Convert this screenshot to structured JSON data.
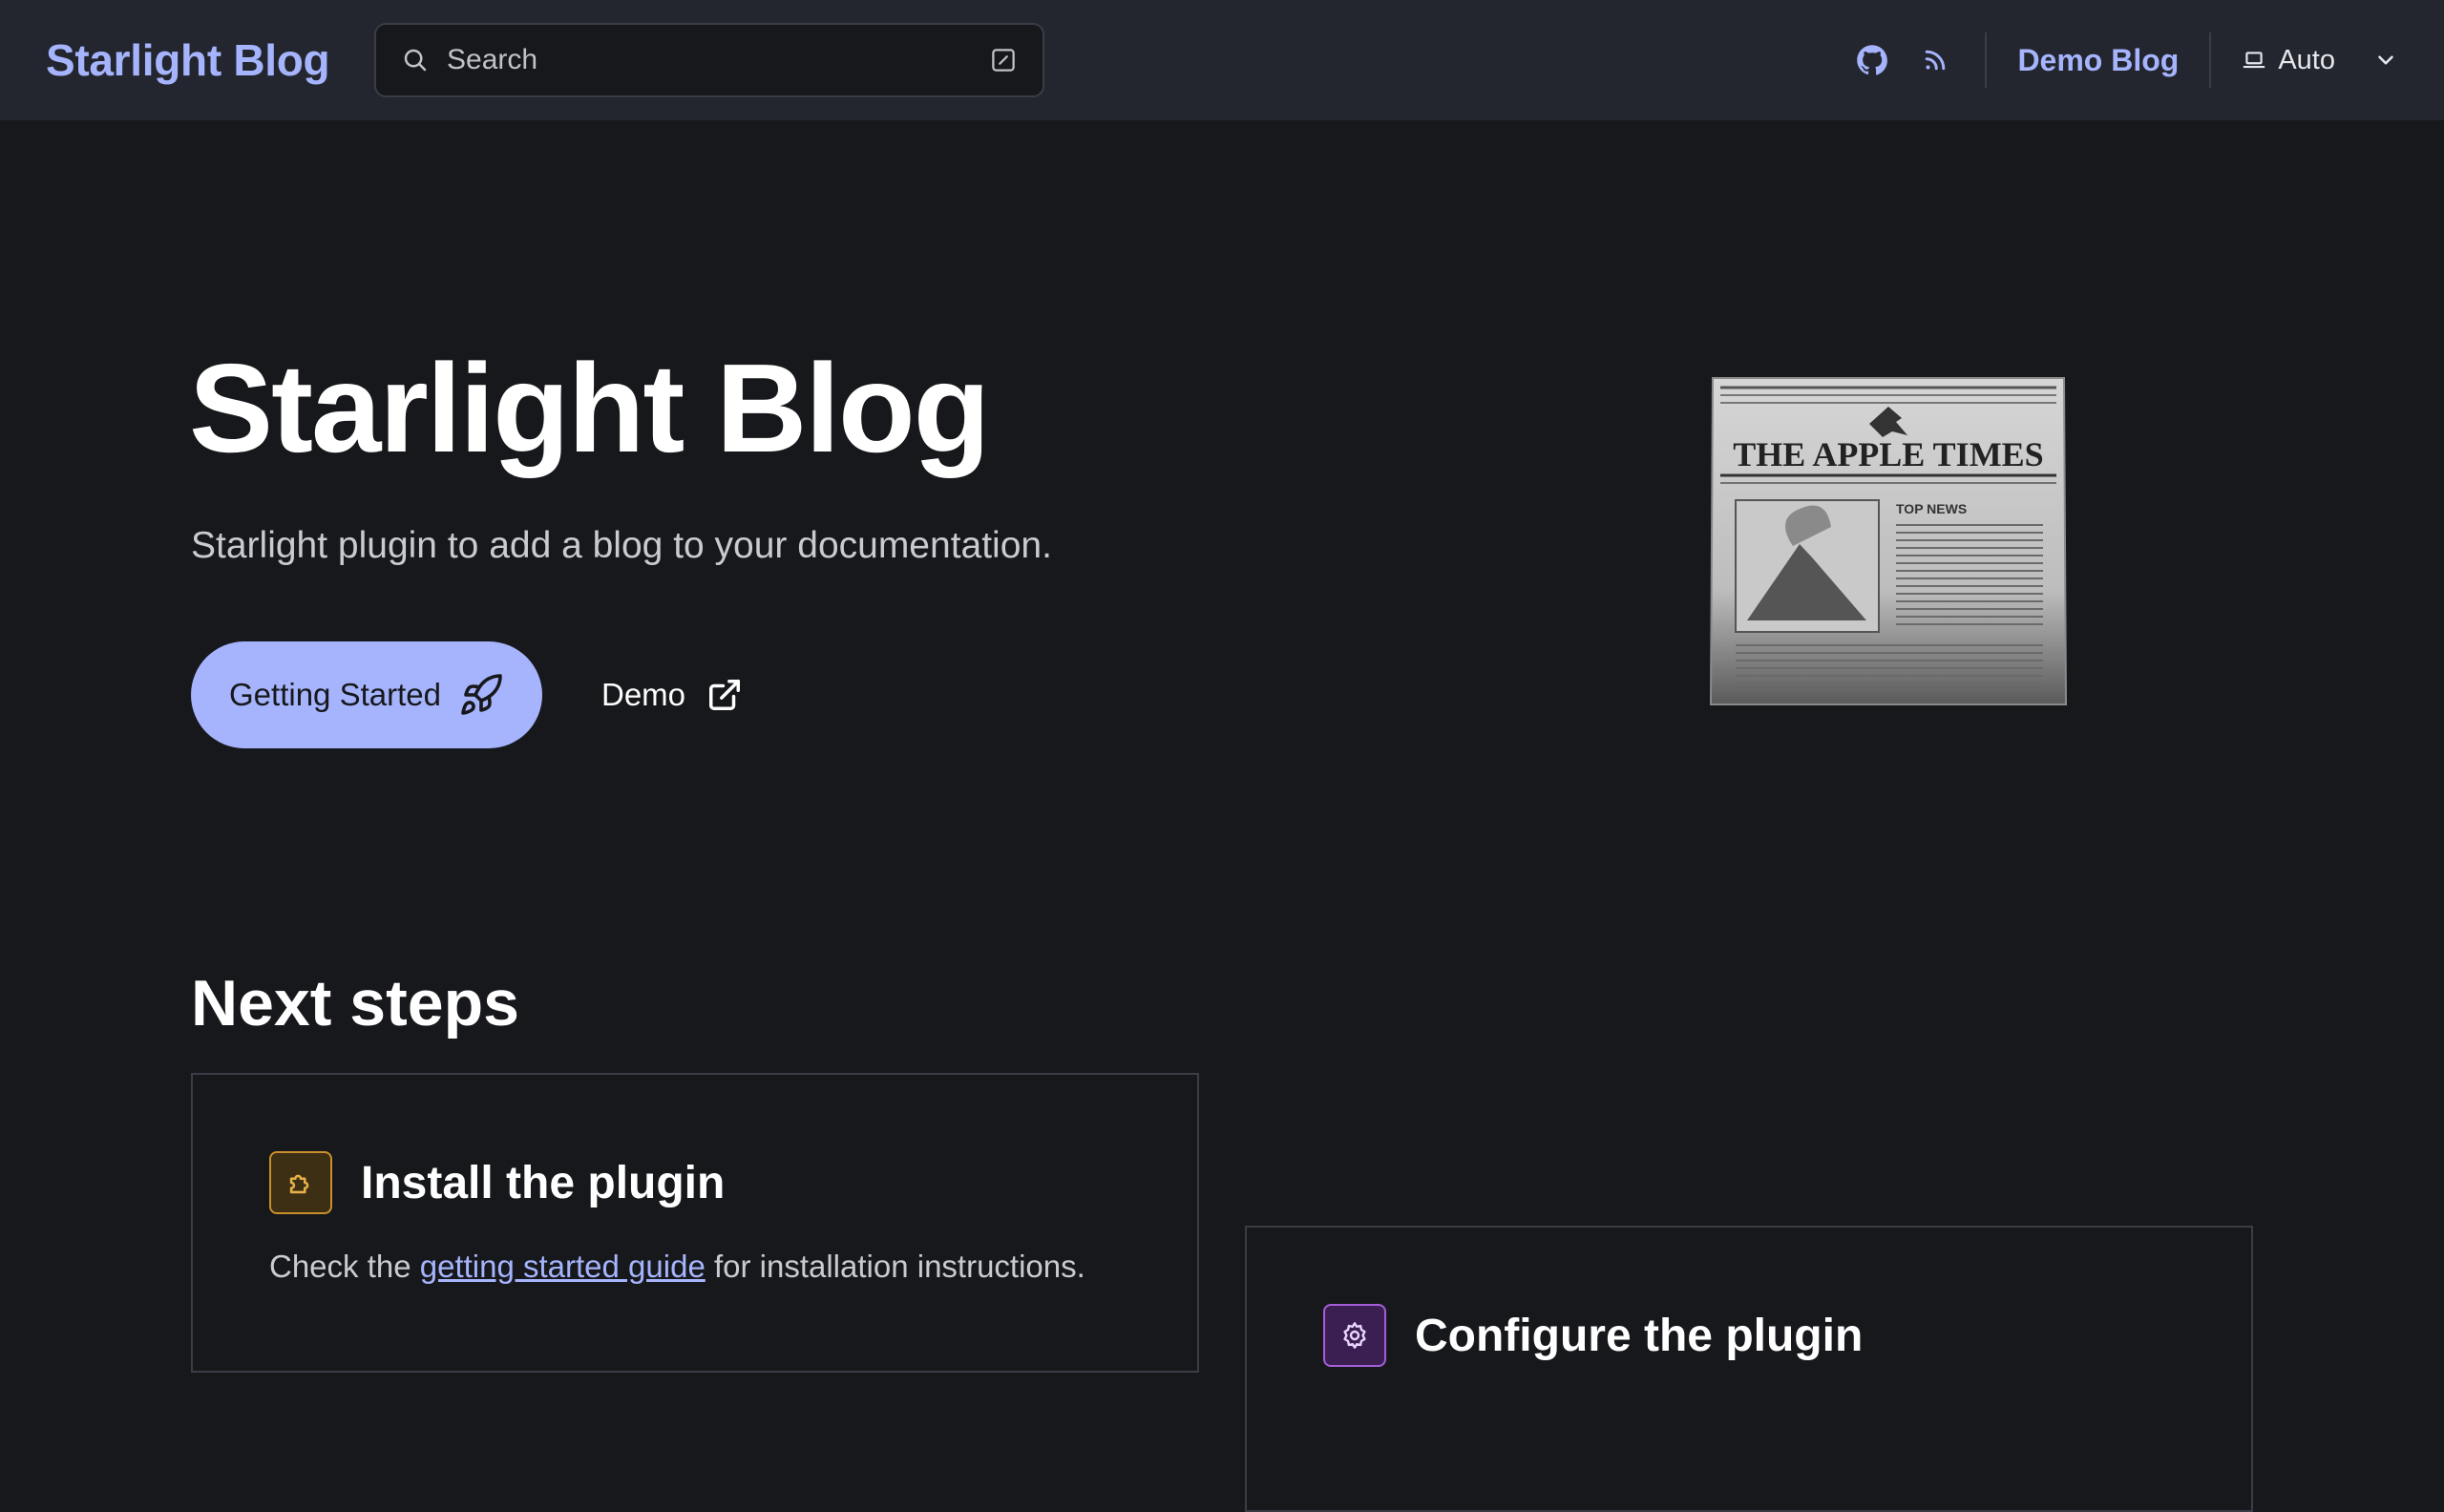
{
  "header": {
    "site_title": "Starlight Blog",
    "search_placeholder": "Search",
    "demo_link": "Demo Blog",
    "theme_label": "Auto"
  },
  "hero": {
    "title": "Starlight Blog",
    "tagline": "Starlight plugin to add a blog to your documentation.",
    "primary_action": "Getting Started",
    "secondary_action": "Demo",
    "image": {
      "masthead": "THE APPLE TIMES",
      "section": "TOP NEWS"
    }
  },
  "next_steps": {
    "title": "Next steps",
    "cards": [
      {
        "title": "Install the plugin",
        "body_prefix": "Check the ",
        "link": "getting started guide",
        "body_suffix": " for installation instructions."
      },
      {
        "title": "Configure the plugin"
      }
    ]
  },
  "colors": {
    "accent": "#a5b4fc",
    "background": "#17181c",
    "header_bg": "#23262f"
  }
}
